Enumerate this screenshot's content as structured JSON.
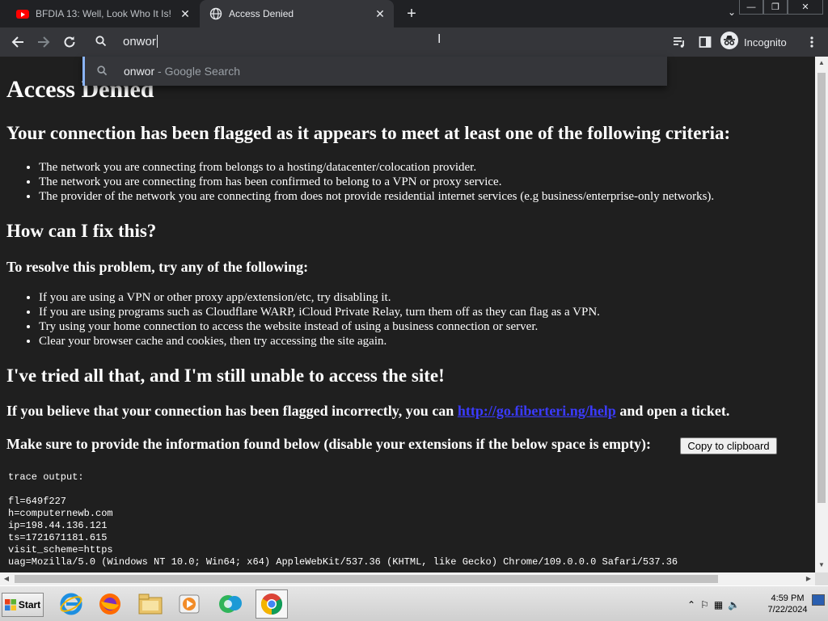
{
  "tabs": [
    {
      "title": "BFDIA 13: Well, Look Who It Is! - YouTube",
      "active": false
    },
    {
      "title": "Access Denied",
      "active": true
    }
  ],
  "omnibox": {
    "text": "onwor"
  },
  "toolbar": {
    "incognito_label": "Incognito"
  },
  "suggestion": {
    "query": "onwor",
    "suffix": " - Google Search"
  },
  "page": {
    "title": "Access Denied",
    "flagged_heading": "Your connection has been flagged as it appears to meet at least one of the following criteria:",
    "criteria": [
      "The network you are connecting from belongs to a hosting/datacenter/colocation provider.",
      "The network you are connecting from has been confirmed to belong to a VPN or proxy service.",
      "The provider of the network you are connecting from does not provide residential internet services (e.g business/enterprise-only networks)."
    ],
    "fix_heading": "How can I fix this?",
    "resolve_heading": "To resolve this problem, try any of the following:",
    "fixes": [
      "If you are using a VPN or other proxy app/extension/etc, try disabling it.",
      "If you are using programs such as Cloudflare WARP, iCloud Private Relay, turn them off as they can flag as a VPN.",
      "Try using your home connection to access the website instead of using a business connection or server.",
      "Clear your browser cache and cookies, then try accessing the site again."
    ],
    "tried_heading": "I've tried all that, and I'm still unable to access the site!",
    "incorrect_before": "If you believe that your connection has been flagged incorrectly, you can ",
    "incorrect_link": "http://go.fiberteri.ng/help",
    "incorrect_after": " and open a ticket.",
    "provide_text": "Make sure to provide the information found below (disable your extensions if the below space is empty):",
    "copy_button": "Copy to clipboard",
    "trace_label": "trace output:",
    "trace_lines": [
      "fl=649f227",
      "h=computernewb.com",
      "ip=198.44.136.121",
      "ts=1721671181.615",
      "visit_scheme=https",
      "uag=Mozilla/5.0 (Windows NT 10.0; Win64; x64) AppleWebKit/537.36 (KHTML, like Gecko) Chrome/109.0.0.0 Safari/537.36"
    ]
  },
  "taskbar": {
    "start_label": "Start",
    "apps": [
      "internet-explorer",
      "firefox",
      "file-explorer",
      "media-player",
      "messenger",
      "chrome"
    ],
    "clock_time": "4:59 PM",
    "clock_date": "7/22/2024"
  }
}
